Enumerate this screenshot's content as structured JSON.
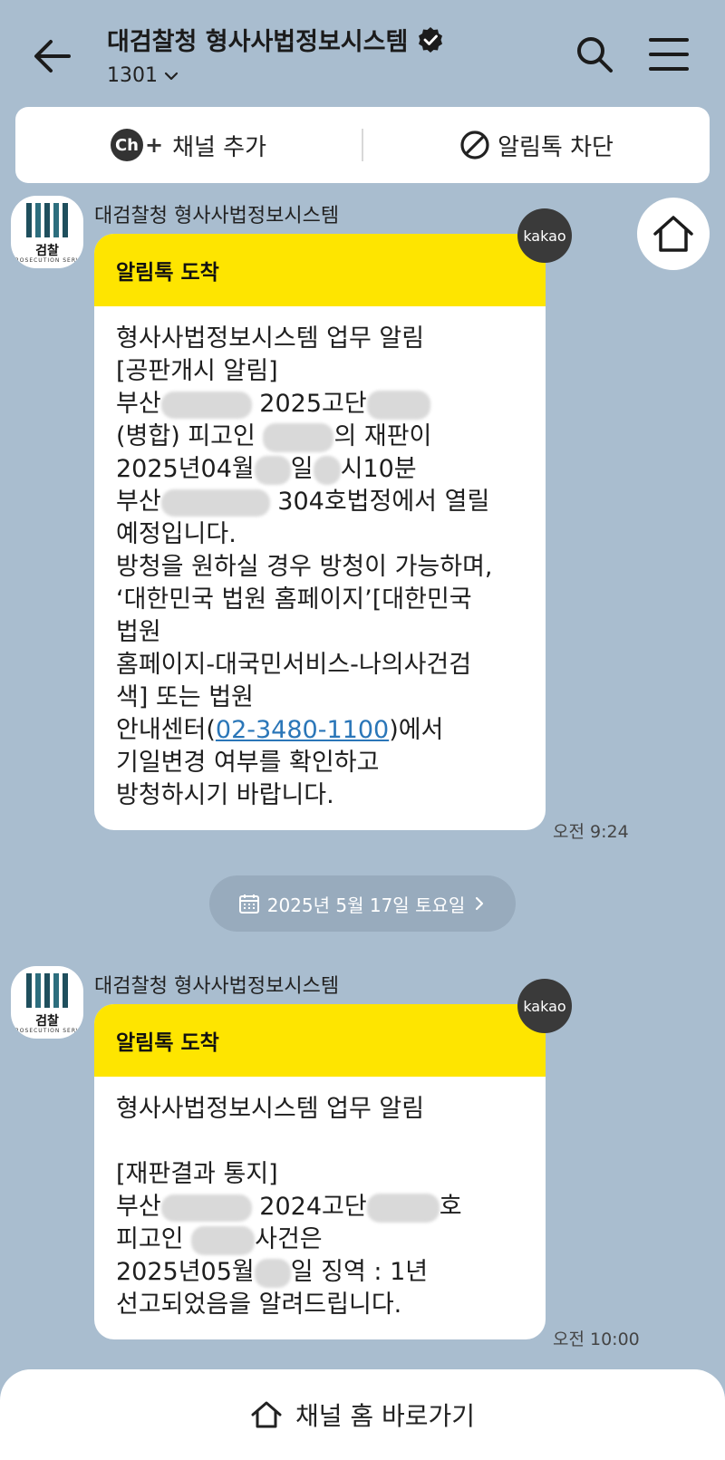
{
  "header": {
    "title": "대검찰청 형사사법정보시스템",
    "subtitle": "1301"
  },
  "action_bar": {
    "add_channel_icon_text": "Ch",
    "add_channel": "채널 추가",
    "block": "알림톡 차단"
  },
  "channel": {
    "name": "대검찰청 형사사법정보시스템",
    "avatar_label": "검찰",
    "avatar_sub": "PROSECUTION SERVICE"
  },
  "messages": [
    {
      "head": "알림톡 도착",
      "badge": "kakao",
      "lines": [
        "형사사법정보시스템 업무 알림",
        "[공판개시 알림]",
        "2025고단",
        "(병합) 피고인",
        "의 재판이",
        "2025년04월",
        "일",
        "시10분",
        "304호법정에서 열릴",
        "예정입니다.",
        "방청을 원하실 경우 방청이 가능하며,",
        "‘대한민국 법원 홈페이지’[대한민국",
        "법원",
        "홈페이지-대국민서비스-나의사건검",
        "색] 또는 법원",
        "안내센터(",
        "02-3480-1100",
        ")에서",
        "기일변경 여부를 확인하고",
        "방청하시기 바랍니다."
      ],
      "prefix_busan": "부산",
      "time": "오전 9:24"
    },
    {
      "head": "알림톡 도착",
      "badge": "kakao",
      "lines": [
        "형사사법정보시스템 업무 알림",
        "[재판결과 통지]",
        "2024고단",
        "호",
        "피고인",
        "사건은",
        "2025년05월",
        "일 징역 : 1년",
        "선고되었음을 알려드립니다."
      ],
      "prefix_busan": "부산",
      "time": "오전 10:00"
    }
  ],
  "date_divider": "2025년 5월 17일 토요일",
  "bottom_bar": {
    "label": "채널 홈 바로가기"
  }
}
